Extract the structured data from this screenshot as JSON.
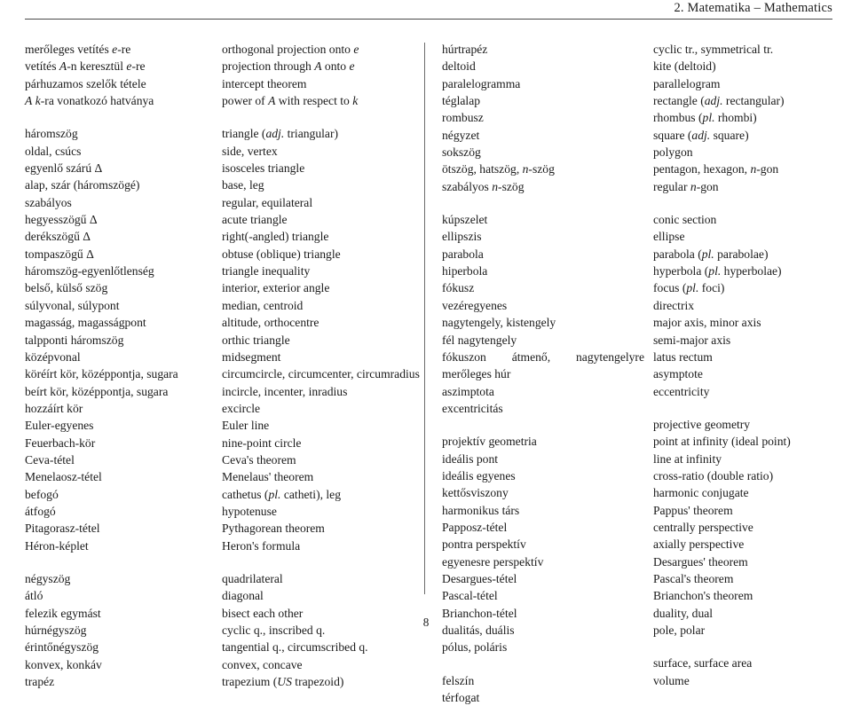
{
  "header": {
    "title": "2. Matematika – Mathematics"
  },
  "folio": {
    "page_number": "8"
  },
  "columns": {
    "left": {
      "hu": {
        "groups": [
          {
            "entries": [
              "merőleges vetítés <i>e</i>-re",
              "vetítés <i>A</i>-n keresztül <i>e</i>-re",
              "párhuzamos szelők tétele",
              "<i>A</i> <i>k</i>-ra vonatkozó hatványa"
            ]
          },
          {
            "entries": [
              "háromszög",
              "oldal, csúcs",
              "egyenlő szárú Δ",
              "alap, szár (háromszögé)",
              "szabályos",
              "hegyesszögű Δ",
              "derékszögű Δ",
              "tompaszögű Δ",
              "háromszög-egyenlőtlenség",
              "belső, külső szög",
              "súlyvonal, súlypont",
              "magasság, magasságpont",
              "talpponti háromszög",
              "középvonal",
              "köréírt kör, középpontja, sugara",
              "beírt kör, középpontja, sugara",
              "hozzáírt kör",
              "Euler-egyenes",
              "Feuerbach-kör",
              "Ceva-tétel",
              "Menelaosz-tétel",
              "befogó",
              "átfogó",
              "Pitagorasz-tétel",
              "Héron-képlet"
            ]
          },
          {
            "entries": [
              "négyszög",
              "átló",
              "felezik egymást",
              "húrnégyszög",
              "érintőnégyszög",
              "konvex, konkáv",
              "trapéz"
            ]
          }
        ]
      },
      "en": {
        "groups": [
          {
            "entries": [
              "orthogonal projection onto <i>e</i>",
              "projection through <i>A</i> onto <i>e</i>",
              "intercept theorem",
              "power of <i>A</i> with respect to <i>k</i>"
            ]
          },
          {
            "entries": [
              "triangle (<i>adj.</i> triangular)",
              "side, vertex",
              "isosceles triangle",
              "base, leg",
              "regular, equilateral",
              "acute triangle",
              "right(-angled) triangle",
              "obtuse (oblique) triangle",
              "triangle inequality",
              "interior, exterior angle",
              "median, centroid",
              "altitude, orthocentre",
              "orthic triangle",
              "midsegment",
              "circumcircle, circumcenter, circumradius",
              "incircle, incenter, inradius",
              "excircle",
              "Euler line",
              "nine-point circle",
              "Ceva's theorem",
              "Menelaus' theorem",
              "cathetus (<i>pl.</i> catheti), leg",
              "hypotenuse",
              "Pythagorean theorem",
              "Heron's formula"
            ]
          },
          {
            "entries": [
              "quadrilateral",
              "diagonal",
              "bisect each other",
              "cyclic q., inscribed q.",
              "tangential q., circumscribed q.",
              "convex, concave",
              "trapezium (<i>US</i> trapezoid)"
            ]
          }
        ]
      }
    },
    "right": {
      "hu": {
        "groups": [
          {
            "entries": [
              "húrtrapéz",
              "deltoid",
              "paralelogramma",
              "téglalap",
              "rombusz",
              "négyzet",
              "sokszög",
              "ötszög, hatszög, <i>n</i>-szög",
              "szabályos <i>n</i>-szög"
            ]
          },
          {
            "entries": [
              "kúpszelet",
              "ellipszis",
              "parabola",
              "hiperbola",
              "fókusz",
              "vezéregyenes",
              "nagytengely, kistengely",
              "fél nagytengely",
              "fókuszon átmenő, nagytengelyre merőleges húr",
              "aszimptota",
              "excentricitás"
            ]
          },
          {
            "entries": [
              "projektív geometria",
              "ideális pont",
              "ideális egyenes",
              "kettősviszony",
              "harmonikus társ",
              "Papposz-tétel",
              "pontra perspektív",
              "egyenesre perspektív",
              "Desargues-tétel",
              "Pascal-tétel",
              "Brianchon-tétel",
              "dualitás, duális",
              "pólus, poláris"
            ]
          },
          {
            "entries": [
              "felszín",
              "térfogat"
            ]
          }
        ]
      },
      "en": {
        "groups": [
          {
            "entries": [
              "cyclic tr., symmetrical tr.",
              "kite (deltoid)",
              "parallelogram",
              "rectangle (<i>adj.</i> rectangular)",
              "rhombus (<i>pl.</i> rhombi)",
              "square (<i>adj.</i> square)",
              "polygon",
              "pentagon, hexagon, <i>n</i>-gon",
              "regular <i>n</i>-gon"
            ]
          },
          {
            "entries": [
              "conic section",
              "ellipse",
              "parabola (<i>pl.</i> parabolae)",
              "hyperbola (<i>pl.</i> hyperbolae)",
              "focus (<i>pl.</i> foci)",
              "directrix",
              "major axis, minor axis",
              "semi-major axis",
              "latus rectum",
              "asymptote",
              "eccentricity"
            ]
          },
          {
            "entries": [
              "projective geometry",
              "point at infinity (ideal point)",
              "line at infinity",
              "cross-ratio (double ratio)",
              "harmonic conjugate",
              "Pappus' theorem",
              "centrally perspective",
              "axially perspective",
              "Desargues' theorem",
              "Pascal's theorem",
              "Brianchon's theorem",
              "duality, dual",
              "pole, polar"
            ]
          },
          {
            "entries": [
              "surface, surface area",
              "volume"
            ]
          }
        ]
      }
    }
  }
}
